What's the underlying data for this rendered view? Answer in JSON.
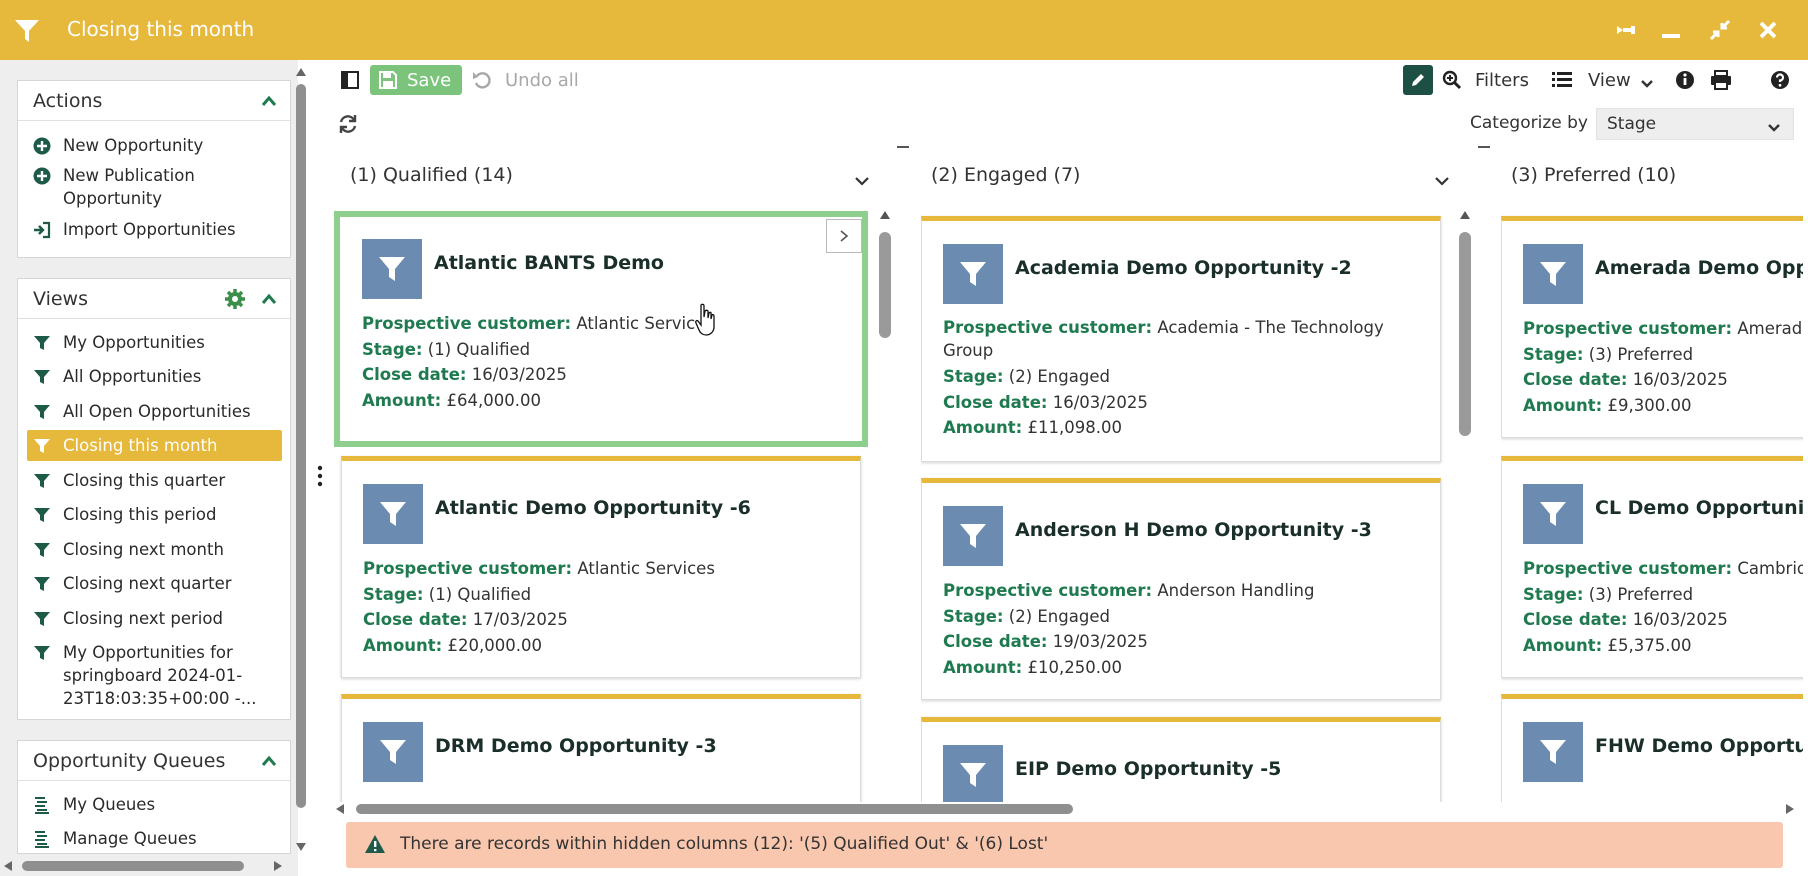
{
  "window": {
    "title": "Closing this month"
  },
  "sidebar": {
    "actions": {
      "title": "Actions",
      "items": [
        {
          "label": "New Opportunity"
        },
        {
          "label": "New Publication Opportunity"
        },
        {
          "label": "Import Opportunities"
        }
      ]
    },
    "views": {
      "title": "Views",
      "items": [
        {
          "label": "My Opportunities"
        },
        {
          "label": "All Opportunities"
        },
        {
          "label": "All Open Opportunities"
        },
        {
          "label": "Closing this month",
          "active": true
        },
        {
          "label": "Closing this quarter"
        },
        {
          "label": "Closing this period"
        },
        {
          "label": "Closing next month"
        },
        {
          "label": "Closing next quarter"
        },
        {
          "label": "Closing next period"
        },
        {
          "label": "My Opportunities for springboard 2024-01-23T18:03:35+00:00 -..."
        }
      ]
    },
    "queues": {
      "title": "Opportunity Queues",
      "items": [
        {
          "label": "My Queues"
        },
        {
          "label": "Manage Queues"
        }
      ]
    }
  },
  "toolbar": {
    "save_label": "Save",
    "undo_label": "Undo all",
    "filters_label": "Filters",
    "view_label": "View",
    "categorize_label": "Categorize by",
    "categorize_value": "Stage"
  },
  "field_labels": {
    "customer": "Prospective customer:",
    "stage": "Stage:",
    "close_date": "Close date:",
    "amount": "Amount:"
  },
  "columns": [
    {
      "title": "(1) Qualified (14)",
      "cards": [
        {
          "name": "Atlantic BANTS Demo",
          "customer": "Atlantic Servic",
          "stage": "(1) Qualified",
          "close_date": "16/03/2025",
          "amount": "£64,000.00"
        },
        {
          "name": "Atlantic Demo Opportunity -6",
          "customer": "Atlantic Services",
          "stage": "(1) Qualified",
          "close_date": "17/03/2025",
          "amount": "£20,000.00"
        },
        {
          "name": "DRM Demo Opportunity -3",
          "customer": "",
          "stage": "",
          "close_date": "",
          "amount": ""
        }
      ]
    },
    {
      "title": "(2) Engaged (7)",
      "cards": [
        {
          "name": "Academia Demo Opportunity -2",
          "customer": "Academia - The Technology Group",
          "stage": "(2) Engaged",
          "close_date": "16/03/2025",
          "amount": "£11,098.00"
        },
        {
          "name": "Anderson H Demo Opportunity -3",
          "customer": "Anderson Handling",
          "stage": "(2) Engaged",
          "close_date": "19/03/2025",
          "amount": "£10,250.00"
        },
        {
          "name": "EIP Demo Opportunity -5",
          "customer": "",
          "stage": "",
          "close_date": "",
          "amount": ""
        }
      ]
    },
    {
      "title": "(3) Preferred (10)",
      "cards": [
        {
          "name": "Amerada Demo Opp",
          "customer": "Amerada",
          "stage": "(3) Preferred",
          "close_date": "16/03/2025",
          "amount": "£9,300.00"
        },
        {
          "name": "CL Demo Opportuni",
          "customer": "Cambrid",
          "stage": "(3) Preferred",
          "close_date": "16/03/2025",
          "amount": "£5,375.00"
        },
        {
          "name": "FHW Demo Opportu",
          "customer": "",
          "stage": "",
          "close_date": "",
          "amount": ""
        }
      ]
    }
  ],
  "warning": {
    "text": "There are records within hidden columns (12): '(5) Qualified Out' & '(6) Lost'"
  },
  "colors": {
    "accent": "#e6b83c",
    "dark_green": "#1e4f44",
    "label_green": "#1f7a4f",
    "avatar_blue": "#6b8bb1",
    "warning_bg": "#f9c6ae",
    "save_green": "#7cc47c"
  }
}
